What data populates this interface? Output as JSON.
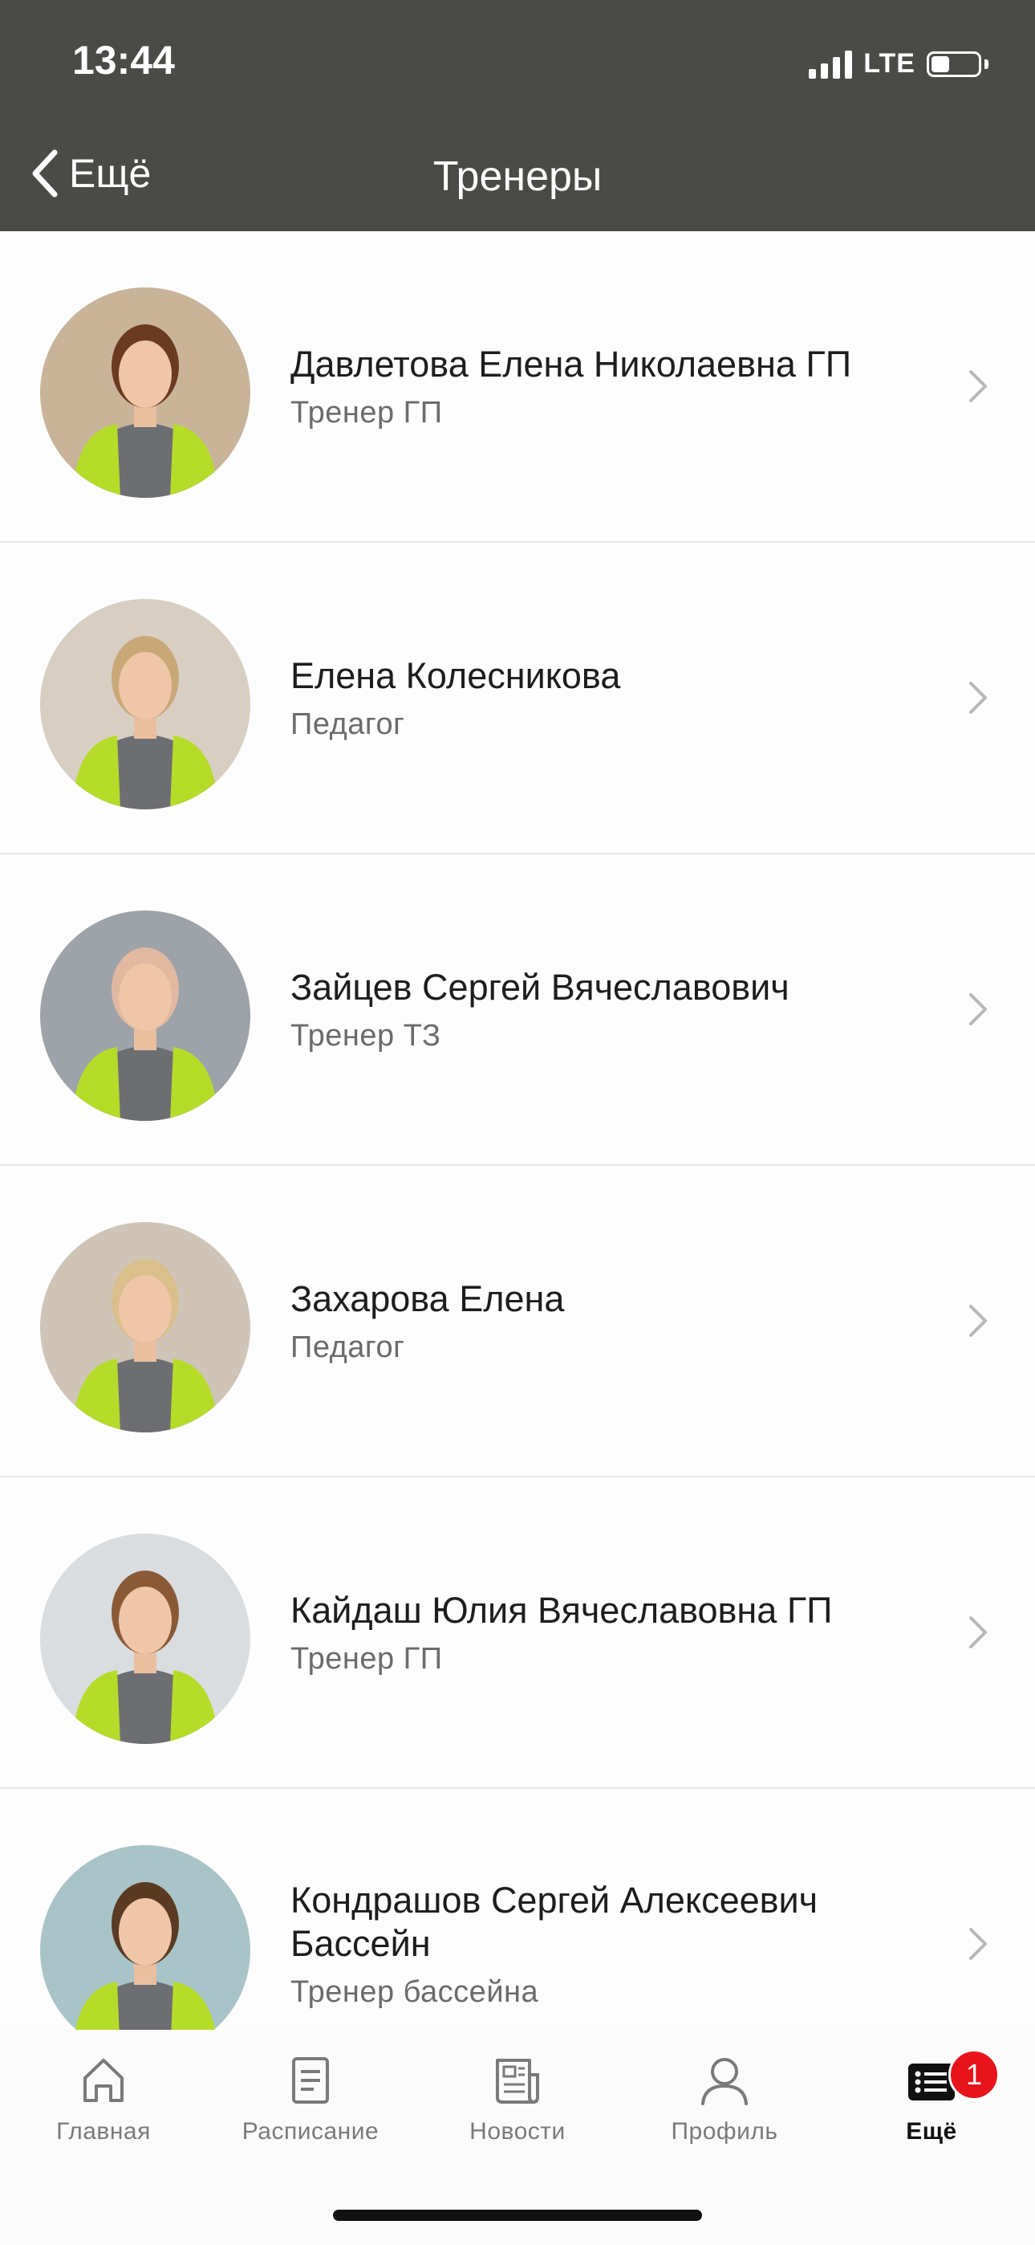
{
  "status": {
    "time": "13:44",
    "network": "LTE",
    "battery_level": 0.4
  },
  "nav": {
    "back_label": "Ещё",
    "title": "Тренеры"
  },
  "trainers": [
    {
      "name": "Давлетова Елена Николаевна ГП",
      "role": "Тренер ГП"
    },
    {
      "name": "Елена Колесникова",
      "role": "Педагог"
    },
    {
      "name": "Зайцев Сергей Вячеславович",
      "role": "Тренер ТЗ"
    },
    {
      "name": "Захарова Елена",
      "role": "Педагог"
    },
    {
      "name": "Кайдаш Юлия Вячеславовна ГП",
      "role": "Тренер ГП"
    },
    {
      "name": "Кондрашов Сергей Алексеевич Бассейн",
      "role": "Тренер бассейна"
    }
  ],
  "tabs": [
    {
      "label": "Главная",
      "icon": "home-icon"
    },
    {
      "label": "Расписание",
      "icon": "schedule-icon"
    },
    {
      "label": "Новости",
      "icon": "news-icon"
    },
    {
      "label": "Профиль",
      "icon": "profile-icon"
    },
    {
      "label": "Ещё",
      "icon": "more-list-icon",
      "badge": "1",
      "active": true
    }
  ],
  "colors": {
    "header_bg": "#4a4a47",
    "badge": "#e8141c",
    "shirt_accent": "#b6dc2a",
    "shirt_main": "#6d6e72"
  }
}
